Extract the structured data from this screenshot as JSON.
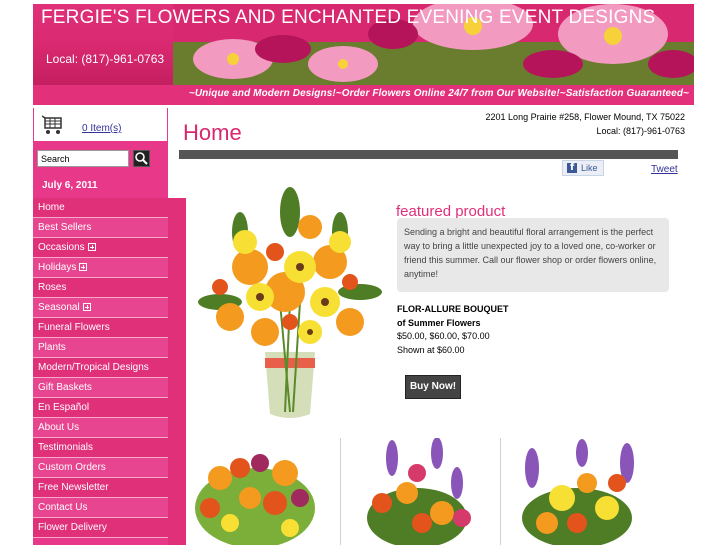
{
  "header": {
    "title": "FERGIE'S FLOWERS AND ENCHANTED EVENING EVENT DESIGNS",
    "phone": "Local: (817)-961-0763",
    "tagline": "~Unique and Modern Designs!~Order Flowers Online 24/7 from Our Website!~Satisfaction Guaranteed~"
  },
  "cart": {
    "label": "0 Item(s)",
    "icon": "shopping-cart-icon"
  },
  "search": {
    "placeholder": "Search",
    "icon": "search-icon"
  },
  "date": "July 6, 2011",
  "nav": [
    {
      "label": "Home",
      "expandable": false
    },
    {
      "label": "Best Sellers",
      "expandable": false
    },
    {
      "label": "Occasions",
      "expandable": true
    },
    {
      "label": "Holidays",
      "expandable": true
    },
    {
      "label": "Roses",
      "expandable": false
    },
    {
      "label": "Seasonal",
      "expandable": true
    },
    {
      "label": "Funeral Flowers",
      "expandable": false
    },
    {
      "label": "Plants",
      "expandable": false
    },
    {
      "label": "Modern/Tropical Designs",
      "expandable": false
    },
    {
      "label": "Gift Baskets",
      "expandable": false
    },
    {
      "label": "En Español",
      "expandable": false
    },
    {
      "label": "About Us",
      "expandable": false
    },
    {
      "label": "Testimonials",
      "expandable": false
    },
    {
      "label": "Custom Orders",
      "expandable": false
    },
    {
      "label": "Free Newsletter",
      "expandable": false
    },
    {
      "label": "Contact Us",
      "expandable": false
    },
    {
      "label": "Flower Delivery",
      "expandable": false
    }
  ],
  "main": {
    "title": "Home",
    "address_line1": "2201 Long Prairie #258, Flower Mound, TX 75022",
    "address_line2": "Local: (817)-961-0763",
    "like_label": "Like",
    "tweet_label": "Tweet",
    "featured": {
      "heading": "featured product",
      "description": "Sending a bright and beautiful floral arrangement is the perfect way to bring a little unexpected joy to a loved one, co-worker or friend this summer. Call our flower shop or order flowers online, anytime!",
      "name_line1": "FLOR-ALLURE BOUQUET",
      "name_line2": "of Summer Flowers",
      "prices": "$50.00, $60.00, $70.00",
      "shown_at": "Shown at $60.00",
      "buy_label": "Buy Now!"
    }
  },
  "colors": {
    "brand_pink": "#e0307a",
    "nav_pink": "#e84590",
    "dark_bar": "#555555"
  }
}
